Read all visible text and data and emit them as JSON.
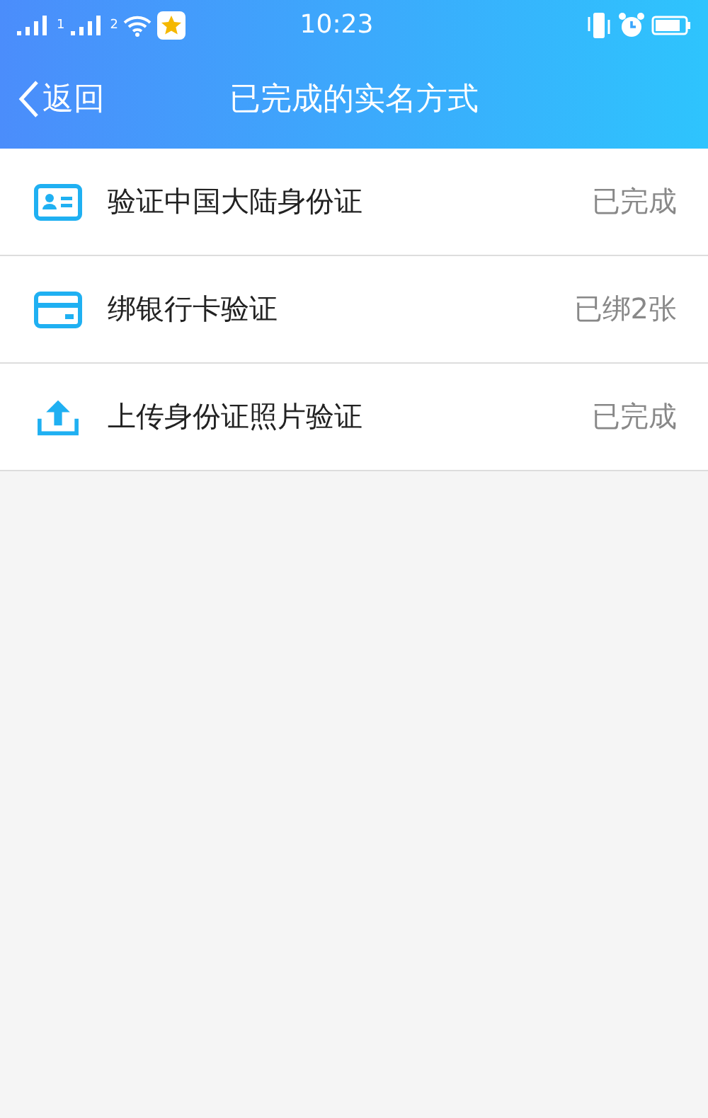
{
  "status_bar": {
    "sims": [
      {
        "label": "1"
      },
      {
        "label": "2"
      }
    ],
    "time": "10:23"
  },
  "nav": {
    "back": "返回",
    "title": "已完成的实名方式"
  },
  "items": [
    {
      "kind": "id-card",
      "label": "验证中国大陆身份证",
      "status": "已完成"
    },
    {
      "kind": "bank-card",
      "label": "绑银行卡验证",
      "status": "已绑2张"
    },
    {
      "kind": "upload",
      "label": "上传身份证照片验证",
      "status": "已完成"
    }
  ]
}
